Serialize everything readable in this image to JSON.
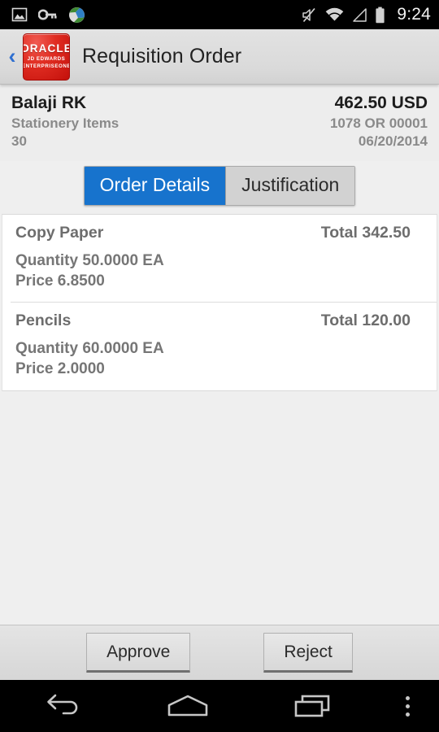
{
  "status_bar": {
    "icons_left": [
      "screenshot-image-icon",
      "vpn-key-icon",
      "globe-browser-icon"
    ],
    "icons_right": [
      "volume-muted-icon",
      "wifi-icon",
      "cell-signal-icon",
      "battery-icon"
    ],
    "time": "9:24"
  },
  "app_bar": {
    "back_label": "‹",
    "logo": {
      "brand": "ORACLE",
      "line2": "JD EDWARDS",
      "line3": "ENTERPRISEONE",
      "color": "#d4160f"
    },
    "title": "Requisition Order"
  },
  "summary": {
    "requester": "Balaji RK",
    "description": "Stationery Items",
    "status_code": "30",
    "amount": "462.50 USD",
    "order_number": "1078 OR 00001",
    "date": "06/20/2014"
  },
  "tabs": {
    "active_color": "#1773cd",
    "items": [
      {
        "label": "Order Details",
        "active": true
      },
      {
        "label": "Justification",
        "active": false
      }
    ]
  },
  "line_items": [
    {
      "name": "Copy Paper",
      "total": "Total 342.50",
      "quantity": "Quantity 50.0000 EA",
      "price": "Price 6.8500"
    },
    {
      "name": "Pencils",
      "total": "Total 120.00",
      "quantity": "Quantity 60.0000 EA",
      "price": "Price 2.0000"
    }
  ],
  "actions": {
    "approve_label": "Approve",
    "reject_label": "Reject"
  },
  "nav_bar": {
    "back": "back-icon",
    "home": "home-icon",
    "recents": "recents-icon",
    "overflow": "overflow-menu-icon"
  }
}
